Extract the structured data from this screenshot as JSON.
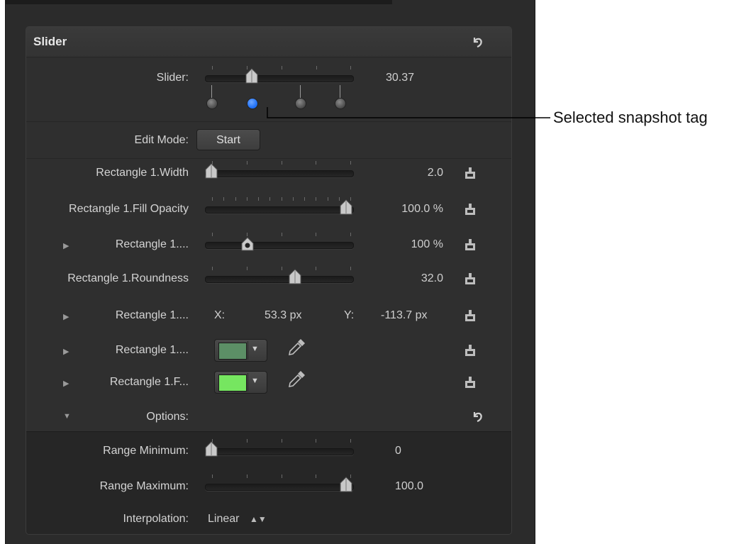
{
  "group": {
    "title": "Slider"
  },
  "slider_row": {
    "label": "Slider:",
    "value": "30.37",
    "position": 0.3,
    "snapshots": [
      {
        "position": 0.0,
        "selected": false
      },
      {
        "position": 0.3,
        "selected": true
      },
      {
        "position": 0.66,
        "selected": false
      },
      {
        "position": 0.95,
        "selected": false
      }
    ]
  },
  "edit_mode": {
    "label": "Edit Mode:",
    "button": "Start"
  },
  "params": [
    {
      "label": "Rectangle 1.Width",
      "value": "2.0",
      "position": 0.0,
      "expandable": false
    },
    {
      "label": "Rectangle 1.Fill Opacity",
      "value": "100.0  %",
      "position": 1.0,
      "expandable": false
    },
    {
      "label": "Rectangle 1....",
      "value": "100 %",
      "position": 0.27,
      "expandable": true
    },
    {
      "label": "Rectangle 1.Roundness",
      "value": "32.0",
      "position": 0.62,
      "expandable": false
    }
  ],
  "position_row": {
    "label": "Rectangle 1....",
    "x_label": "X:",
    "x_value": "53.3  px",
    "y_label": "Y:",
    "y_value": "-113.7  px"
  },
  "color_rows": [
    {
      "label": "Rectangle 1....",
      "color": "#5c8f66"
    },
    {
      "label": "Rectangle 1.F...",
      "color": "#76e660"
    }
  ],
  "options": {
    "label": "Options:",
    "range_min": {
      "label": "Range Minimum:",
      "value": "0",
      "position": 0.0
    },
    "range_max": {
      "label": "Range Maximum:",
      "value": "100.0",
      "position": 1.0
    },
    "interpolation": {
      "label": "Interpolation:",
      "value": "Linear"
    }
  },
  "callout": {
    "text": "Selected snapshot tag"
  },
  "icons": {
    "reset": "reset-arrow-icon",
    "rig": "rig-link-icon",
    "disclosure": "disclosure-triangle-icon",
    "eyedropper": "eyedropper-icon"
  },
  "colors": {
    "panel_bg": "#2b2b2b",
    "selected_tag": "#1e6ff5"
  }
}
